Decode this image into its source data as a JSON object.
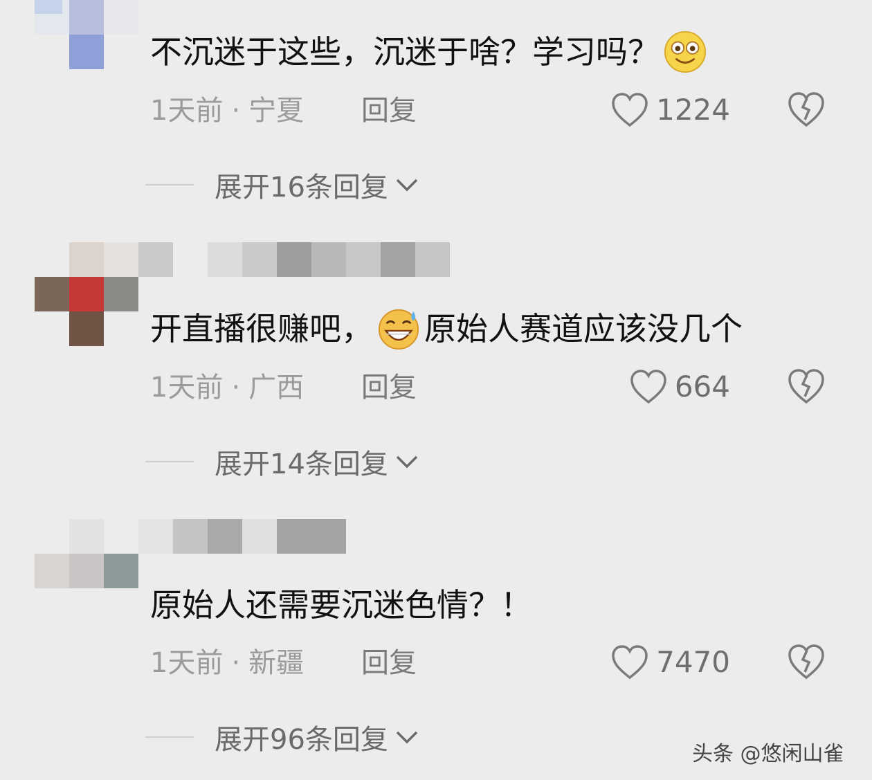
{
  "comments": [
    {
      "text_before": "不沉迷于这些，沉迷于啥？学习吗？",
      "text_after": "",
      "emoji": "smiling-face-emoji",
      "time": "1天前",
      "location": "宁夏",
      "reply_label": "回复",
      "likes": "1224",
      "expand_label": "展开16条回复"
    },
    {
      "text_before": "开直播很赚吧，",
      "text_after": "原始人赛道应该没几个",
      "emoji": "grinning-sweat-emoji",
      "time": "1天前",
      "location": "广西",
      "reply_label": "回复",
      "likes": "664",
      "expand_label": "展开14条回复"
    },
    {
      "text_before": "原始人还需要沉迷色情？！",
      "text_after": "",
      "emoji": "",
      "time": "1天前",
      "location": "新疆",
      "reply_label": "回复",
      "likes": "7470",
      "expand_label": "展开96条回复"
    }
  ],
  "separator": "·",
  "watermark": "头条 @悠闲山雀",
  "icons": {
    "like": "heart-outline-icon",
    "dislike": "broken-heart-icon",
    "expand": "chevron-down-icon"
  },
  "colors": {
    "background": "#ececec",
    "text": "#111111",
    "meta": "#9b9b9b"
  }
}
